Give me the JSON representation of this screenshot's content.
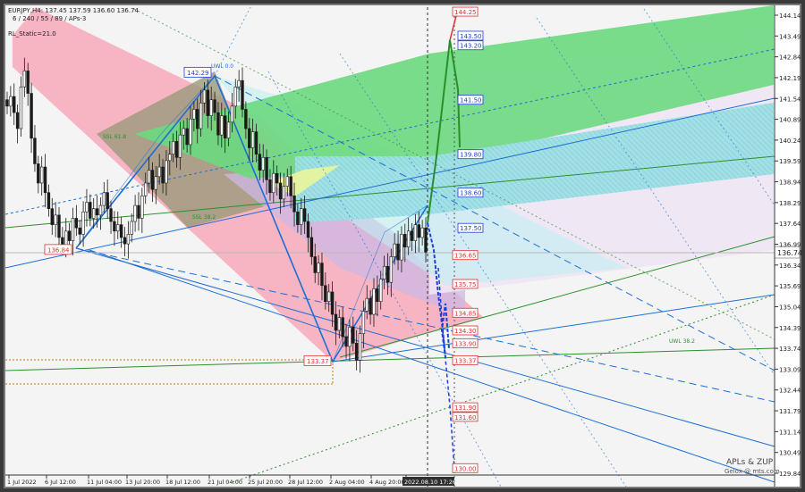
{
  "header": {
    "symbol_line": "EURJPY,H4: 137.45 137.59 136.60 136.74",
    "params_line": "6 / 240 / 55 / 89 / APs-3",
    "static_line": "RL_Static=21.0"
  },
  "watermark": {
    "line1": "APLs & ZUP",
    "line2": "Gelox @ mts.com"
  },
  "colors": {
    "bg": "#f4f4f4",
    "frame": "#3a3a3a",
    "pink": "#f7a8b8",
    "green": "#6bd97f",
    "cyan": "#9ee0e6",
    "lavender": "#efe6f4",
    "olive_gray": "#9a9a7a",
    "candle": "#1a1a1a",
    "blue_line": "#1e6fd6",
    "green_line": "#2f8f2f",
    "red_label": "#e03030"
  },
  "annotations": {
    "chart_labels": [
      "142.29",
      "136.84",
      "133.37"
    ],
    "blue_levels": [
      "143.50",
      "143.20",
      "141.50",
      "139.80",
      "138.60",
      "137.50"
    ],
    "red_levels": [
      "144.25",
      "136.65",
      "135.75",
      "134.85",
      "134.30",
      "133.90",
      "133.37",
      "131.90",
      "131.60",
      "130.00"
    ],
    "fan_labels": [
      "UWL 0.0",
      "SSL 61.8",
      "SSL 38.2",
      "UWL 38.2"
    ]
  },
  "chart_data": {
    "type": "candlestick",
    "symbol": "EURJPY",
    "timeframe": "H4",
    "ohlc_last": {
      "open": 137.45,
      "high": 137.59,
      "low": 136.6,
      "close": 136.74
    },
    "current_price": "136.74",
    "y_ticks": [
      "144.14",
      "143.49",
      "142.84",
      "142.19",
      "141.54",
      "140.89",
      "140.24",
      "139.59",
      "138.94",
      "138.29",
      "137.64",
      "136.99",
      "136.34",
      "135.69",
      "135.04",
      "134.39",
      "133.74",
      "133.09",
      "132.44",
      "131.79",
      "131.14",
      "130.49",
      "129.84"
    ],
    "x_ticks": [
      "1 Jul 2022",
      "6 Jul 12:00",
      "11 Jul 04:00",
      "13 Jul 20:00",
      "18 Jul 12:00",
      "21 Jul 04:00",
      "25 Jul 20:00",
      "28 Jul 12:00",
      "2 Aug 04:00",
      "4 Aug 20:00",
      "2022.08.10 17:26"
    ],
    "ylim": [
      129.84,
      144.4
    ],
    "pivots": [
      {
        "label": "136.84",
        "value": 136.84
      },
      {
        "label": "142.29",
        "value": 142.29
      },
      {
        "label": "133.37",
        "value": 133.37
      }
    ],
    "closes": [
      141.3,
      141.6,
      141.1,
      140.6,
      141.9,
      142.4,
      141.7,
      140.3,
      139.5,
      138.9,
      139.4,
      138.6,
      138.1,
      137.6,
      137.9,
      137.2,
      136.9,
      137.4,
      137.1,
      137.8,
      137.5,
      137.3,
      138.0,
      138.3,
      137.8,
      138.1,
      137.9,
      138.2,
      138.6,
      138.1,
      137.7,
      137.4,
      137.6,
      137.2,
      137.0,
      137.3,
      137.7,
      138.2,
      137.8,
      138.5,
      138.9,
      139.3,
      138.7,
      139.1,
      139.4,
      138.9,
      139.6,
      139.8,
      140.2,
      139.7,
      140.4,
      140.6,
      140.1,
      140.9,
      141.2,
      140.6,
      141.4,
      141.8,
      141.0,
      141.5,
      141.1,
      140.4,
      141.0,
      140.3,
      140.8,
      141.3,
      141.9,
      142.1,
      141.2,
      140.6,
      140.0,
      140.5,
      139.8,
      139.3,
      139.7,
      139.0,
      138.6,
      139.2,
      138.9,
      138.4,
      138.8,
      139.1,
      138.5,
      138.0,
      137.6,
      138.1,
      137.7,
      137.2,
      136.6,
      136.1,
      136.4,
      135.7,
      135.2,
      135.5,
      134.8,
      134.3,
      134.7,
      134.1,
      133.8,
      134.4,
      133.9,
      133.37,
      134.2,
      134.9,
      135.3,
      134.8,
      135.6,
      135.2,
      135.9,
      136.3,
      135.8,
      136.6,
      137.0,
      136.5,
      137.3,
      136.9,
      137.4,
      137.1,
      137.6,
      137.2,
      137.5,
      136.74
    ]
  }
}
